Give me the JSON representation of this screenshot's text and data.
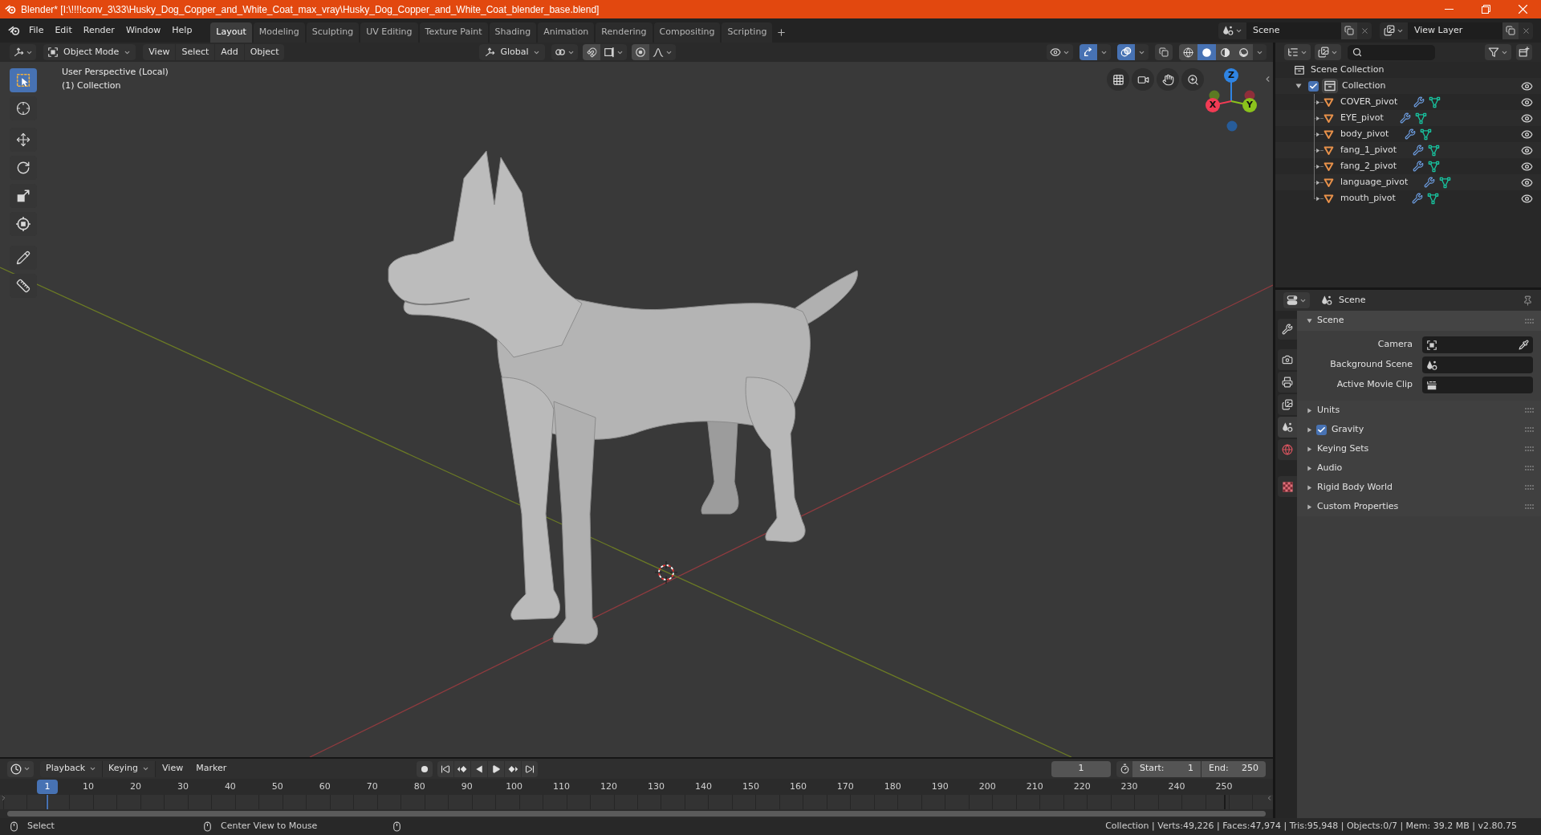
{
  "window": {
    "title": "Blender* [I:\\!!!!conv_3\\33\\Husky_Dog_Copper_and_White_Coat_max_vray\\Husky_Dog_Copper_and_White_Coat_blender_base.blend]"
  },
  "menus": [
    "File",
    "Edit",
    "Render",
    "Window",
    "Help"
  ],
  "workspaces": [
    {
      "label": "Layout",
      "selected": true
    },
    {
      "label": "Modeling",
      "selected": false
    },
    {
      "label": "Sculpting",
      "selected": false
    },
    {
      "label": "UV Editing",
      "selected": false
    },
    {
      "label": "Texture Paint",
      "selected": false
    },
    {
      "label": "Shading",
      "selected": false
    },
    {
      "label": "Animation",
      "selected": false
    },
    {
      "label": "Rendering",
      "selected": false
    },
    {
      "label": "Compositing",
      "selected": false
    },
    {
      "label": "Scripting",
      "selected": false
    }
  ],
  "scene_selector": {
    "value": "Scene"
  },
  "view_layer_selector": {
    "value": "View Layer"
  },
  "viewport": {
    "header": {
      "mode": "Object Mode",
      "menus": [
        "View",
        "Select",
        "Add",
        "Object"
      ],
      "orientation": "Global",
      "toggles": [
        {
          "kind": "snap",
          "on": false
        },
        {
          "kind": "proportional",
          "on": false
        },
        {
          "kind": "gizmos",
          "on": true
        },
        {
          "kind": "overlays",
          "on": true
        },
        {
          "kind": "xray",
          "on": false
        }
      ],
      "shading": [
        {
          "kind": "wireframe",
          "selected": false
        },
        {
          "kind": "solid",
          "selected": true
        },
        {
          "kind": "material",
          "selected": false
        },
        {
          "kind": "rendered",
          "selected": false
        }
      ]
    },
    "tools": [
      {
        "kind": "select_box",
        "selected": true
      },
      {
        "kind": "cursor",
        "selected": false
      },
      {
        "kind": "move",
        "selected": false
      },
      {
        "kind": "rotate",
        "selected": false
      },
      {
        "kind": "scale",
        "selected": false
      },
      {
        "kind": "transform",
        "selected": false
      },
      {
        "kind": "annotate",
        "selected": false
      },
      {
        "kind": "measure",
        "selected": false
      }
    ],
    "info": [
      "User Perspective (Local)",
      "(1) Collection"
    ],
    "gizmo_axes": [
      "Z",
      "Y",
      "X"
    ]
  },
  "outliner": {
    "root": "Scene Collection",
    "collections": [
      {
        "label": "Collection",
        "checked": true,
        "expanded": true,
        "children": [
          {
            "label": "COVER_pivot",
            "expanded": false
          },
          {
            "label": "EYE_pivot",
            "expanded": false
          },
          {
            "label": "body_pivot",
            "expanded": false
          },
          {
            "label": "fang_1_pivot",
            "expanded": false
          },
          {
            "label": "fang_2_pivot",
            "expanded": false
          },
          {
            "label": "language_pivot",
            "expanded": false
          },
          {
            "label": "mouth_pivot",
            "expanded": false
          }
        ]
      }
    ]
  },
  "properties": {
    "context": "Scene",
    "tabs": [
      {
        "kind": "tool",
        "selected": false
      },
      {
        "kind": "render",
        "selected": false
      },
      {
        "kind": "output",
        "selected": false
      },
      {
        "kind": "view_layer",
        "selected": false
      },
      {
        "kind": "scene",
        "selected": true
      },
      {
        "kind": "world",
        "selected": false
      },
      {
        "kind": "texture",
        "selected": false
      }
    ],
    "panels": [
      {
        "label": "Scene",
        "expanded": true,
        "fields": [
          {
            "kind": "camera",
            "label": "Camera"
          },
          {
            "kind": "scene",
            "label": "Background Scene"
          },
          {
            "kind": "clip",
            "label": "Active Movie Clip"
          }
        ]
      },
      {
        "label": "Units",
        "expanded": false
      },
      {
        "label": "Gravity",
        "expanded": false,
        "checked": true
      },
      {
        "label": "Keying Sets",
        "expanded": false
      },
      {
        "label": "Audio",
        "expanded": false
      },
      {
        "label": "Rigid Body World",
        "expanded": false
      },
      {
        "label": "Custom Properties",
        "expanded": false
      }
    ]
  },
  "timeline": {
    "menus": [
      {
        "kind": "dropdown",
        "label": "Playback"
      },
      {
        "kind": "dropdown",
        "label": "Keying"
      },
      {
        "kind": "menu",
        "label": "View"
      },
      {
        "kind": "menu",
        "label": "Marker"
      }
    ],
    "frame": "1",
    "start_label": "Start:",
    "start": "1",
    "end_label": "End:",
    "end": "250",
    "current_frame_badge": "1",
    "ruler_labels": [
      "10",
      "20",
      "30",
      "40",
      "50",
      "60",
      "70",
      "80",
      "90",
      "100",
      "110",
      "120",
      "130",
      "140",
      "150",
      "160",
      "170",
      "180",
      "190",
      "200",
      "210",
      "220",
      "230",
      "240",
      "250"
    ]
  },
  "status_bar": {
    "hints": [
      "Select",
      "Center View to Mouse"
    ],
    "stats": "Collection | Verts:49,226 | Faces:47,974 | Tris:95,948 | Objects:0/7 | Mem: 39.2 MB | v2.80.75"
  }
}
